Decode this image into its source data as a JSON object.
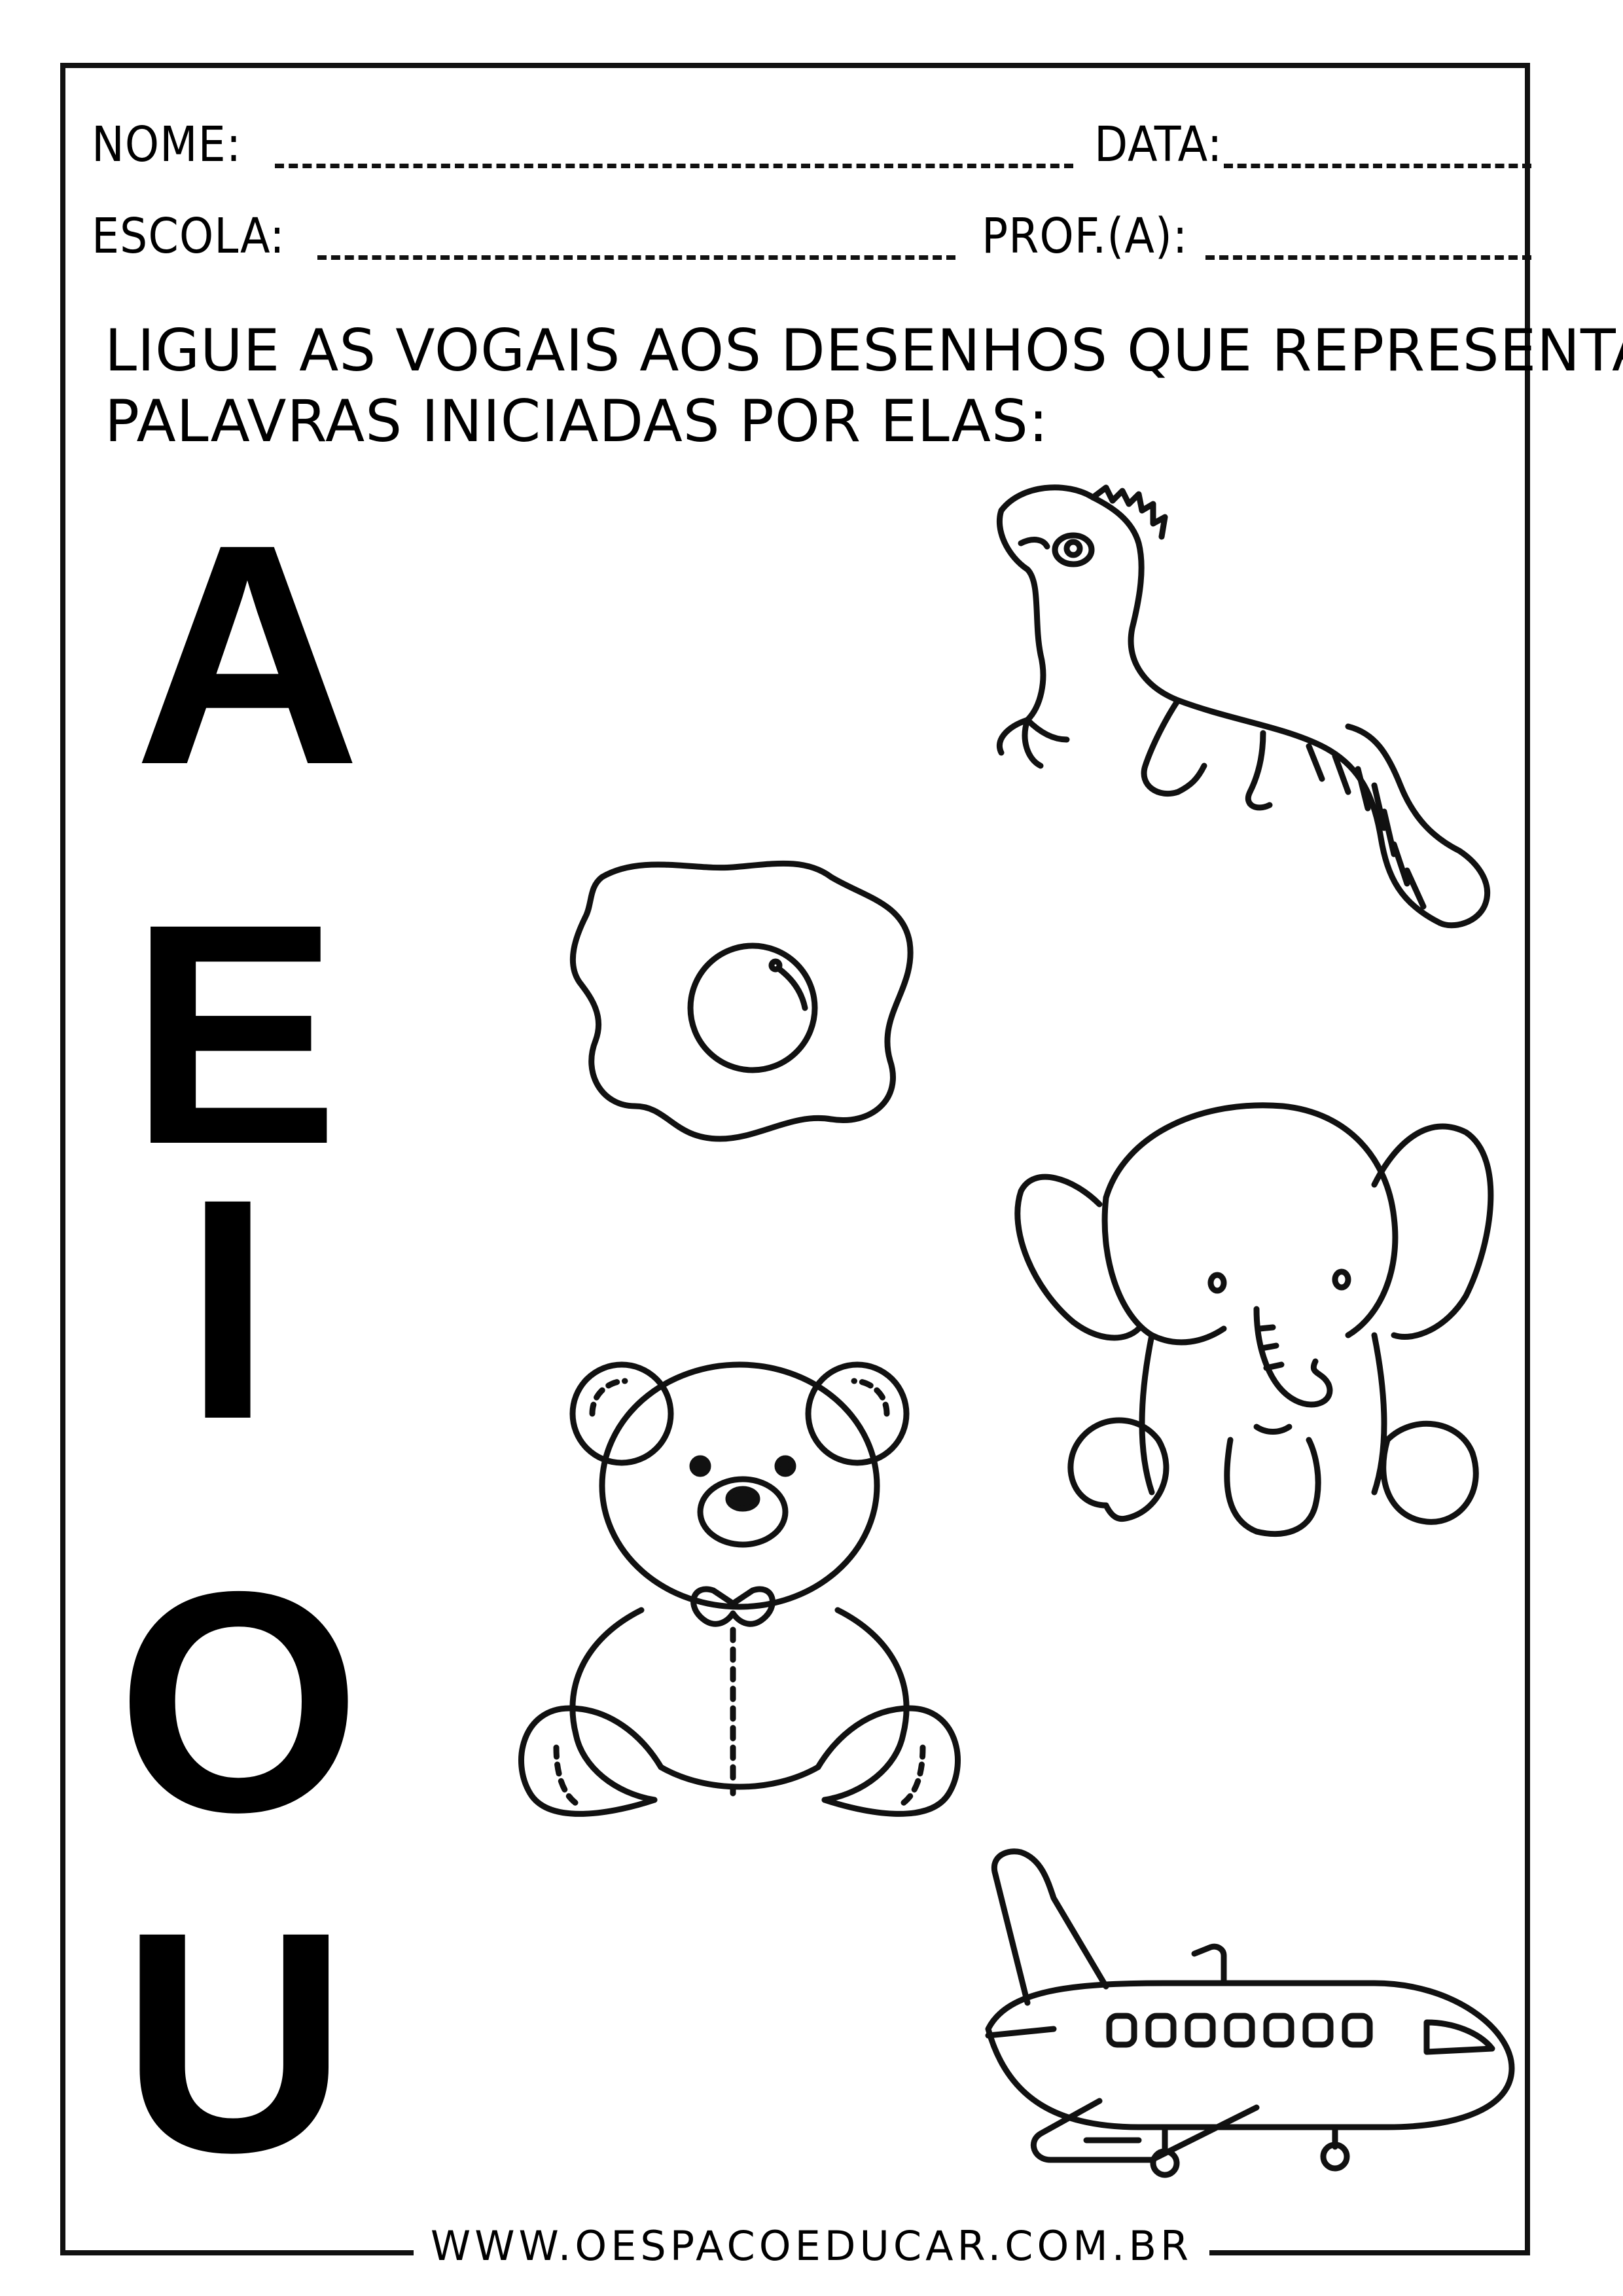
{
  "header": {
    "name_label": "NOME:",
    "date_label": "DATA:",
    "school_label": "ESCOLA:",
    "teacher_label": "PROF.(A):"
  },
  "instruction": {
    "line1": "LIGUE AS VOGAIS AOS DESENHOS QUE  REPRESENTAM",
    "line2": "PALAVRAS INICIADAS POR ELAS:"
  },
  "vowels": [
    "A",
    "E",
    "I",
    "O",
    "U"
  ],
  "pictures": [
    "iguana-icon",
    "fried-egg-icon",
    "elephant-icon",
    "teddy-bear-icon",
    "airplane-icon"
  ],
  "footer": {
    "website": "WWW.OESPACOEDUCAR.COM.BR"
  }
}
